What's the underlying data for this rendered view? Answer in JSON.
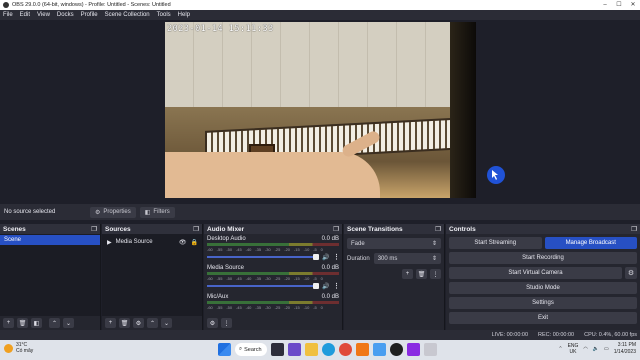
{
  "window": {
    "title": "OBS 29.0.0 (64-bit, windows) - Profile: Untitled - Scenes: Untitled",
    "min": "–",
    "max": "☐",
    "close": "✕"
  },
  "menu": [
    "File",
    "Edit",
    "View",
    "Docks",
    "Profile",
    "Scene Collection",
    "Tools",
    "Help"
  ],
  "preview": {
    "timestamp": "2023-01-14  15:11:33"
  },
  "info_bar": {
    "source_label": "No source selected",
    "properties": "Properties",
    "filters": "Filters"
  },
  "scenes": {
    "title": "Scenes",
    "items": [
      "Scene"
    ]
  },
  "sources": {
    "title": "Sources",
    "items": [
      "Media Source"
    ]
  },
  "mixer": {
    "title": "Audio Mixer",
    "ticks": [
      "-60",
      "-55",
      "-50",
      "-45",
      "-40",
      "-35",
      "-30",
      "-25",
      "-20",
      "-15",
      "-10",
      "-5",
      "0"
    ],
    "channels": [
      {
        "name": "Desktop Audio",
        "level": "0.0 dB"
      },
      {
        "name": "Media Source",
        "level": "0.0 dB"
      },
      {
        "name": "Mic/Aux",
        "level": "0.0 dB"
      }
    ]
  },
  "transitions": {
    "title": "Scene Transitions",
    "selected": "Fade",
    "duration_label": "Duration",
    "duration_value": "300 ms"
  },
  "controls": {
    "title": "Controls",
    "start_streaming": "Start Streaming",
    "manage_broadcast": "Manage Broadcast",
    "start_recording": "Start Recording",
    "start_virtual_camera": "Start Virtual Camera",
    "studio_mode": "Studio Mode",
    "settings": "Settings",
    "exit": "Exit"
  },
  "status": {
    "live": "LIVE: 00:00:00",
    "rec": "REC: 00:00:00",
    "cpu": "CPU: 0.4%, 60.00 fps"
  },
  "taskbar": {
    "temp": "31°C",
    "weather": "Có mây",
    "search": "Search",
    "lang1": "ENG",
    "lang2": "UK",
    "time": "3:11 PM",
    "date": "1/14/2023"
  }
}
